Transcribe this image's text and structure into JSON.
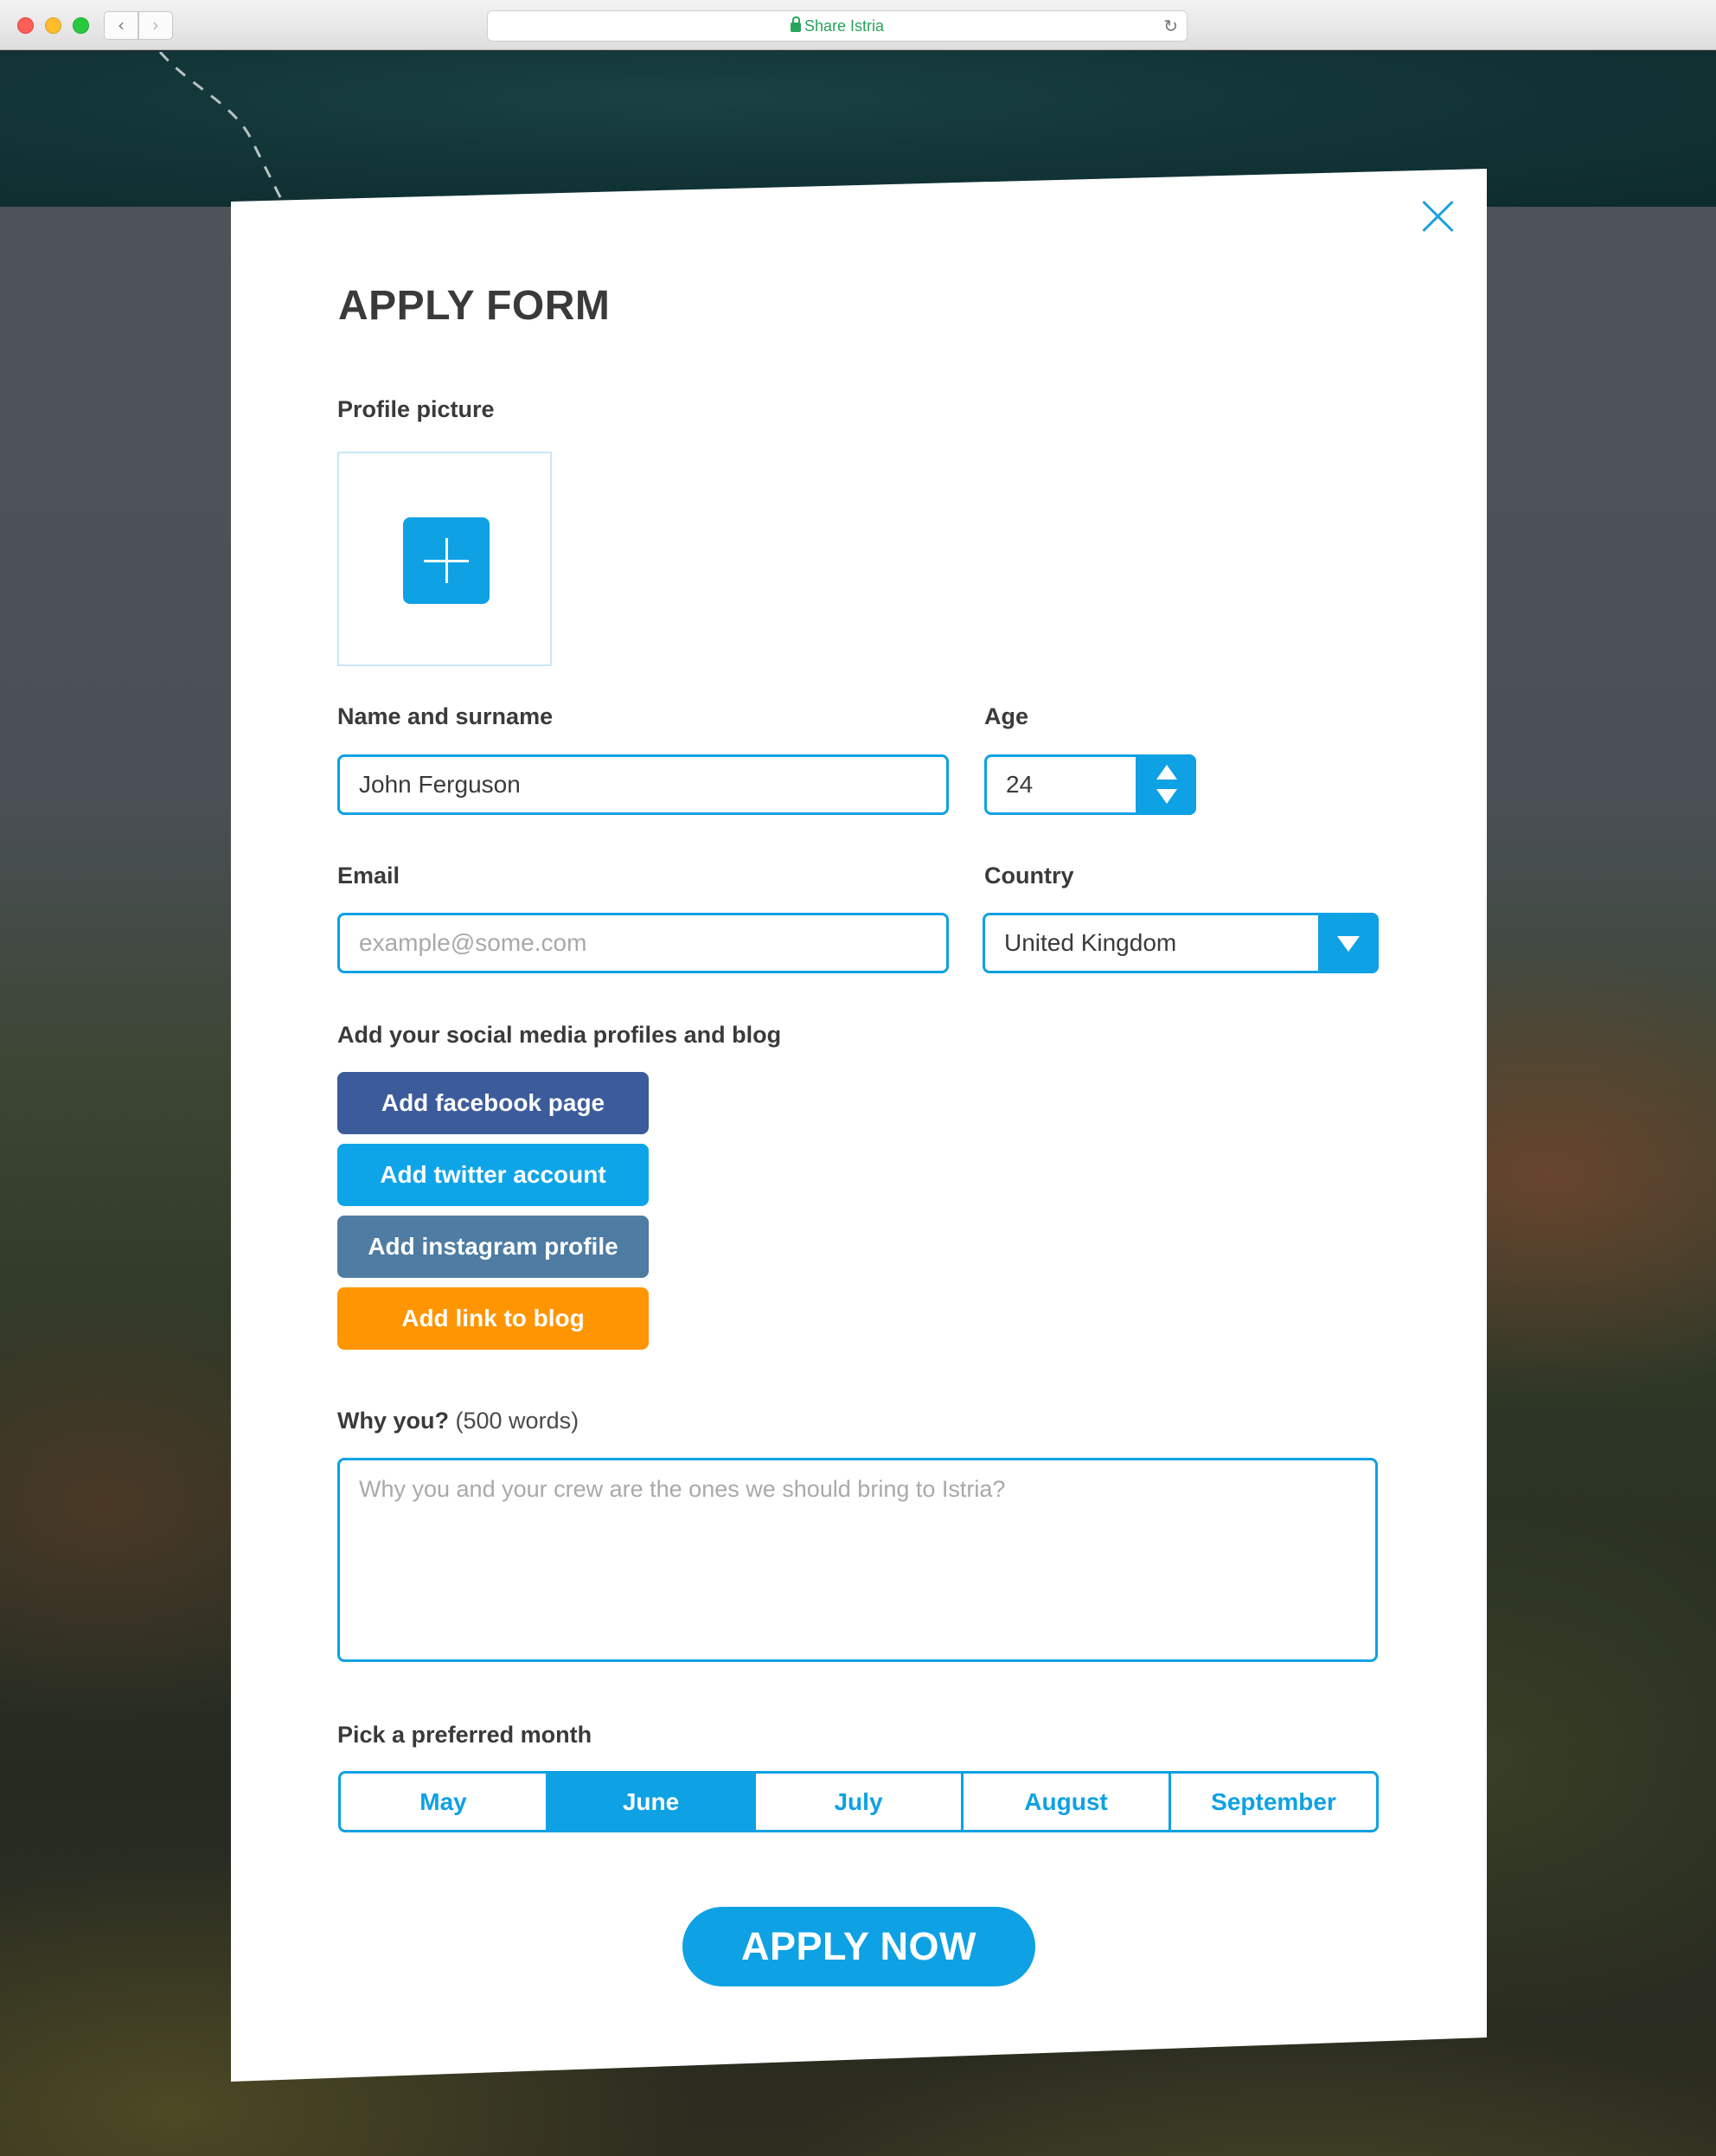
{
  "browser": {
    "url_text": "Share Istria",
    "back_glyph": "‹",
    "forward_glyph": "›",
    "reload_glyph": "↻"
  },
  "form": {
    "title": "APPLY FORM",
    "profile_picture_label": "Profile picture",
    "name_label": "Name and surname",
    "name_value": "John Ferguson",
    "age_label": "Age",
    "age_value": "24",
    "email_label": "Email",
    "email_placeholder": "example@some.com",
    "country_label": "Country",
    "country_value": "United Kingdom",
    "social_label": "Add your social media profiles and blog",
    "social_buttons": {
      "facebook": "Add facebook page",
      "twitter": "Add twitter account",
      "instagram": "Add instagram profile",
      "blog": "Add link to blog"
    },
    "why_label": "Why you?",
    "why_hint": "(500 words)",
    "why_placeholder": "Why you and your crew are the ones we should bring to Istria?",
    "month_label": "Pick a preferred month",
    "months": [
      "May",
      "June",
      "July",
      "August",
      "September"
    ],
    "selected_month": "June",
    "submit_label": "APPLY NOW"
  },
  "colors": {
    "accent": "#0ea1e4",
    "facebook": "#3b5b9b",
    "twitter": "#0ea5e8",
    "instagram": "#4e7ca3",
    "blog": "#ff9500",
    "text": "#3a3a3a"
  },
  "icons": {
    "close": "close-icon",
    "upload": "plus-icon",
    "stepper_up": "arrow-up-icon",
    "stepper_down": "arrow-down-icon",
    "select": "chevron-down-icon",
    "lock": "lock-icon"
  }
}
